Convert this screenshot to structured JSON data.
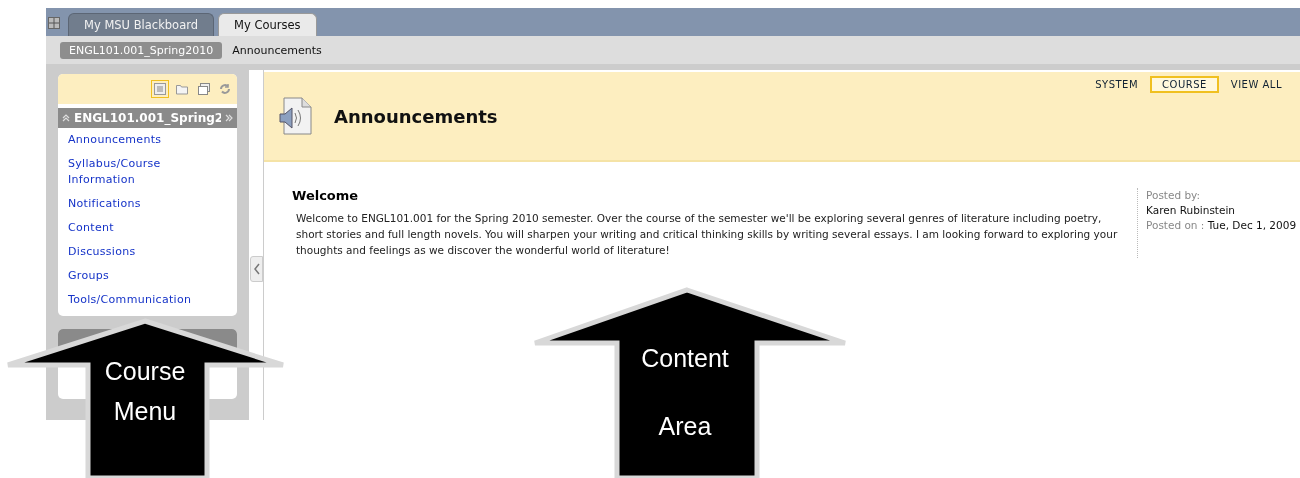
{
  "top_tabs": [
    {
      "label": "My MSU Blackboard",
      "selected": false
    },
    {
      "label": "My Courses",
      "selected": true
    }
  ],
  "breadcrumbs": [
    "ENGL101.001_Spring2010",
    "Announcements"
  ],
  "course_menu": {
    "view_modes": [
      {
        "kind": "list",
        "selected": true
      },
      {
        "kind": "folder",
        "selected": false
      },
      {
        "kind": "window",
        "selected": false
      }
    ],
    "title": "ENGL101.001_Spring2",
    "items": [
      "Announcements",
      "Syllabus/Course Information",
      "Notifications",
      "Content",
      "Discussions",
      "Groups",
      "Tools/Communication"
    ]
  },
  "page": {
    "title": "Announcements",
    "filters": [
      {
        "label": "SYSTEM",
        "selected": false
      },
      {
        "label": "COURSE",
        "selected": true
      },
      {
        "label": "VIEW ALL",
        "selected": false
      }
    ]
  },
  "announcements": [
    {
      "title": "Welcome",
      "body": "Welcome to ENGL101.001 for the Spring 2010 semester.  Over the course of the semester we'll be exploring several genres of literature including poetry, short stories and full length novels.  You will sharpen your writing and critical thinking skills by writing several essays.  I am looking forward to exploring your thoughts and feelings as we discover the wonderful world of literature!",
      "posted_by_label": "Posted by:",
      "author": "Karen Rubinstein",
      "posted_on_label": "Posted on :",
      "date": "Tue, Dec 1, 2009"
    }
  ],
  "callouts": [
    {
      "label": "Course Menu"
    },
    {
      "label": "Content Area"
    }
  ]
}
